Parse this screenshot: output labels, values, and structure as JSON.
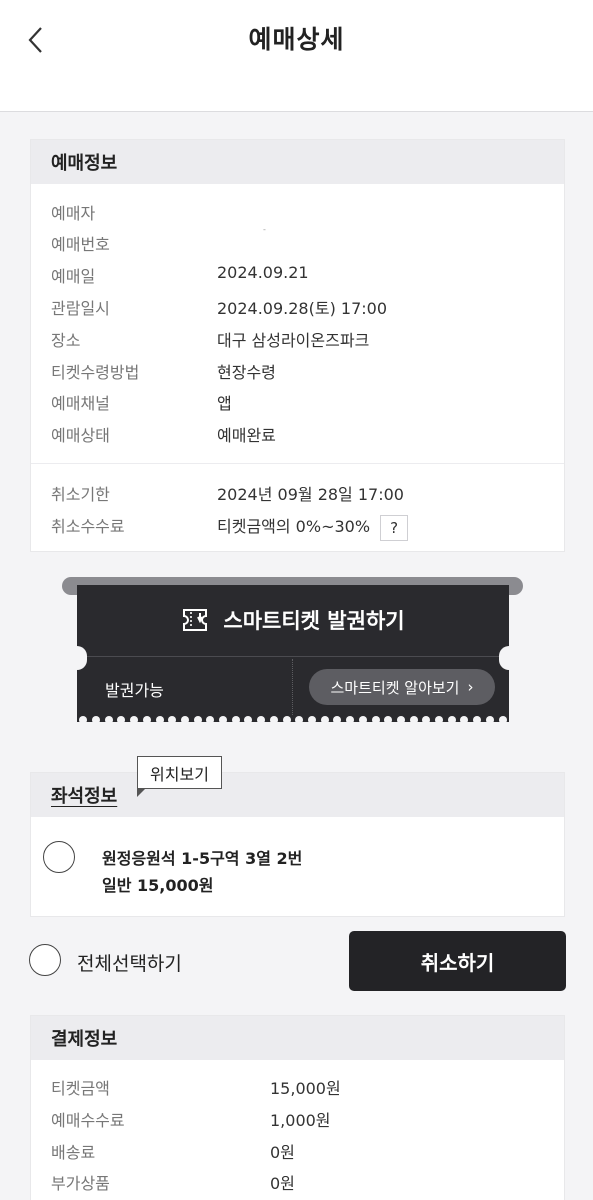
{
  "header": {
    "title": "예매상세",
    "back_icon": "chevron-left-icon"
  },
  "booking_info": {
    "title": "예매정보",
    "rows": [
      {
        "label": "예매자",
        "value": ""
      },
      {
        "label": "예매번호",
        "value": "-"
      },
      {
        "label": "예매일",
        "value": "2024.09.21"
      },
      {
        "label": "관람일시",
        "value": "2024.09.28(토) 17:00"
      },
      {
        "label": "장소",
        "value": "대구 삼성라이온즈파크"
      },
      {
        "label": "티켓수령방법",
        "value": "현장수령"
      },
      {
        "label": "예매채널",
        "value": "앱"
      },
      {
        "label": "예매상태",
        "value": "예매완료"
      }
    ],
    "cancel_rows": [
      {
        "label": "취소기한",
        "value": "2024년 09월 28일 17:00"
      },
      {
        "label": "취소수수료",
        "value": "티켓금액의 0%~30%"
      }
    ],
    "help_label": "?"
  },
  "smart_ticket": {
    "issue_label": "스마트티켓 발권하기",
    "status": "발권가능",
    "learn_more": "스마트티켓 알아보기",
    "learn_more_chevron": "›",
    "icon": "ticket-icon"
  },
  "seat_info": {
    "title": "좌석정보",
    "tooltip": "위치보기",
    "seat": "원정응원석 1-5구역 3열 2번",
    "price": "일반 15,000원"
  },
  "actions": {
    "select_all": "전체선택하기",
    "cancel": "취소하기"
  },
  "payment_info": {
    "title": "결제정보",
    "rows": [
      {
        "label": "티켓금액",
        "value": "15,000원"
      },
      {
        "label": "예매수수료",
        "value": "1,000원"
      },
      {
        "label": "배송료",
        "value": "0원"
      },
      {
        "label": "부가상품",
        "value": "0원"
      }
    ]
  }
}
